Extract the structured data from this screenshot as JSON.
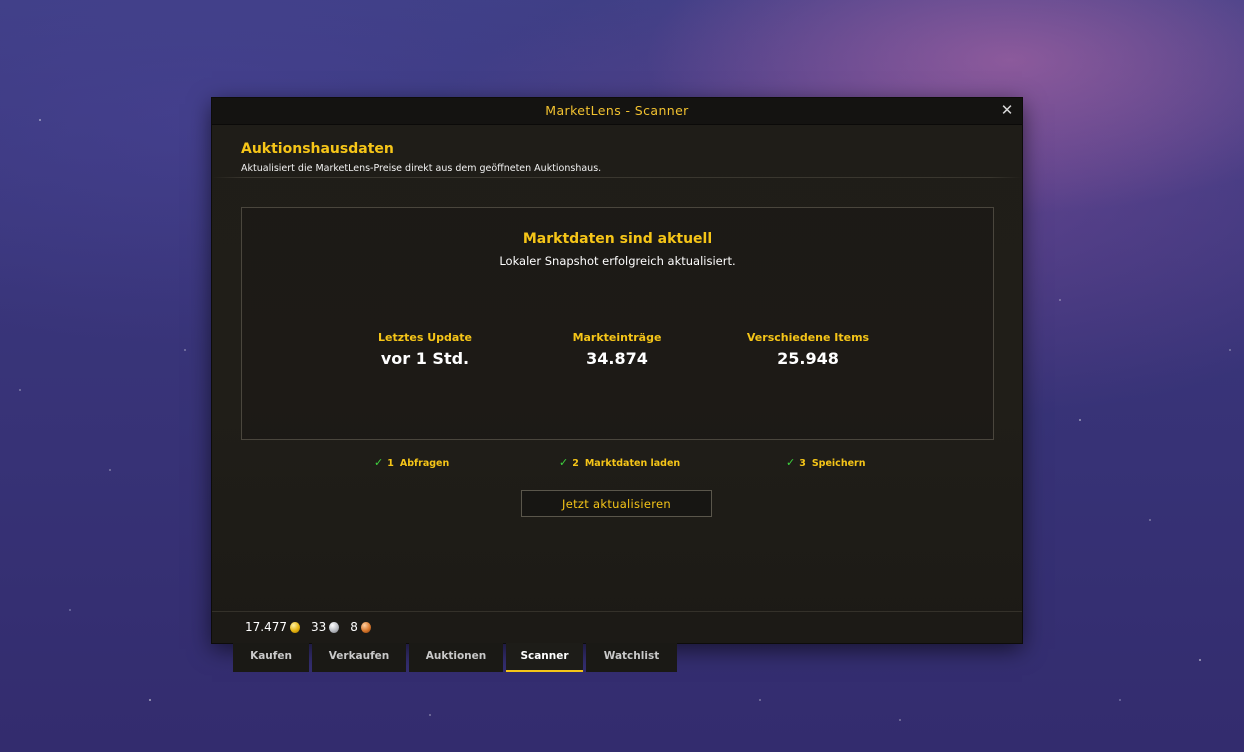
{
  "window": {
    "title": "MarketLens - Scanner",
    "close_label": "✕"
  },
  "section": {
    "title": "Auktionshausdaten",
    "subtitle": "Aktualisiert die MarketLens-Preise direkt aus dem geöffneten Auktionshaus."
  },
  "status": {
    "title": "Marktdaten sind aktuell",
    "subtitle": "Lokaler Snapshot erfolgreich aktualisiert.",
    "stats": [
      {
        "label": "Letztes Update",
        "value": "vor 1 Std."
      },
      {
        "label": "Markteinträge",
        "value": "34.874"
      },
      {
        "label": "Verschiedene Items",
        "value": "25.948"
      }
    ]
  },
  "steps": [
    {
      "check": "✓",
      "number": "1",
      "label": "Abfragen"
    },
    {
      "check": "✓",
      "number": "2",
      "label": "Marktdaten laden"
    },
    {
      "check": "✓",
      "number": "3",
      "label": "Speichern"
    }
  ],
  "refresh_button": "Jetzt aktualisieren",
  "currency": {
    "gold": "17.477",
    "silver": "33",
    "copper": "8"
  },
  "tabs": [
    {
      "label": "Kaufen",
      "active": false
    },
    {
      "label": "Verkaufen",
      "active": false
    },
    {
      "label": "Auktionen",
      "active": false
    },
    {
      "label": "Scanner",
      "active": true
    },
    {
      "label": "Watchlist",
      "active": false
    }
  ],
  "colors": {
    "accent": "#f5c518",
    "check": "#3ed23e",
    "panel_bg": "#201e18"
  }
}
